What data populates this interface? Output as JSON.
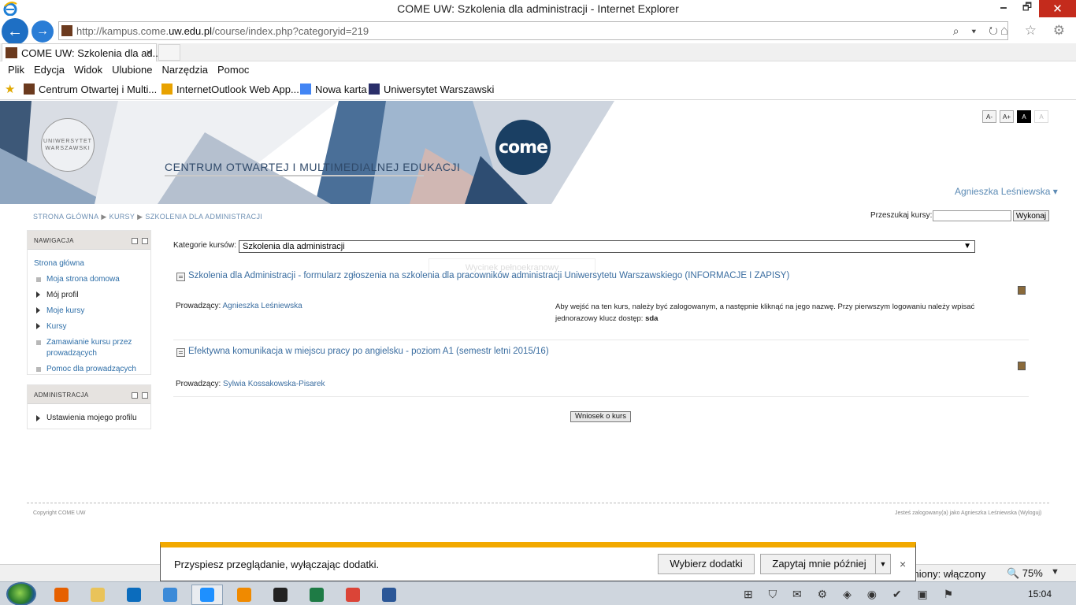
{
  "window": {
    "title": "COME UW: Szkolenia dla administracji - Internet Explorer",
    "minimize": "🗕",
    "maximize": "🗗",
    "close": "✕"
  },
  "address_bar": {
    "url_prefix": "http://kampus.come.",
    "url_domain": "uw.edu.pl",
    "url_suffix": "/course/index.php?categoryid=219",
    "tools": "⌕ ▾ ↻",
    "right_icons": "⌂ ☆ ⚙"
  },
  "tab": {
    "label": "COME UW: Szkolenia dla ad...",
    "close": "×"
  },
  "menu": [
    "Plik",
    "Edycja",
    "Widok",
    "Ulubione",
    "Narzędzia",
    "Pomoc"
  ],
  "favorites": [
    {
      "label": "Centrum Otwartej i Multi...",
      "color": "#6b3a1e"
    },
    {
      "label": "InternetOutlook Web App...",
      "color": "#e8a200"
    },
    {
      "label": "Nowa karta",
      "color": "#4285f4"
    },
    {
      "label": "Uniwersytet Warszawski",
      "color": "#2a2f6a"
    }
  ],
  "banner": {
    "seal_text": "UNIWERSYTET WARSZAWSKI",
    "title": "CENTRUM OTWARTEJ I MULTIMEDIALNEJ EDUKACJI",
    "logo": "come"
  },
  "accessibility": [
    "A-",
    "A+",
    "A",
    "A"
  ],
  "user": {
    "name": "Agnieszka Leśniewska ▾"
  },
  "breadcrumb": [
    "STRONA GŁÓWNA",
    "KURSY",
    "SZKOLENIA DLA ADMINISTRACJI"
  ],
  "search": {
    "label": "Przeszukaj kursy:",
    "button": "Wykonaj",
    "value": ""
  },
  "navigation": {
    "title": "NAWIGACJA",
    "root": "Strona główna",
    "items": [
      {
        "label": "Moja strona domowa"
      },
      {
        "label": "Mój profil"
      },
      {
        "label": "Moje kursy"
      },
      {
        "label": "Kursy"
      },
      {
        "label": "Zamawianie kursu przez prowadzących"
      },
      {
        "label": "Pomoc dla prowadzących"
      }
    ]
  },
  "administration": {
    "title": "ADMINISTRACJA",
    "item": "Ustawienia mojego profilu"
  },
  "categories": {
    "label": "Kategorie kursów:",
    "selected": "Szkolenia dla administracji",
    "ghost": "Wycinek pełnoekranowy"
  },
  "courses": [
    {
      "name": "Szkolenia dla Administracji - formularz zgłoszenia na szkolenia dla pracowników administracji Uniwersytetu Warszawskiego (INFORMACJE I ZAPISY)",
      "teacher_label": "Prowadzący:",
      "teacher": "Agnieszka Leśniewska",
      "summary": "Aby wejść na ten kurs, należy być zalogowanym, a następnie kliknąć na jego nazwę. Przy pierwszym logowaniu należy wpisać jednorazowy klucz dostęp:",
      "key": "sda"
    },
    {
      "name": "Efektywna komunikacja w miejscu pracy po angielsku - poziom A1 (semestr letni 2015/16)",
      "teacher_label": "Prowadzący:",
      "teacher": "Sylwia Kossakowska-Pisarek"
    }
  ],
  "request_button": "Wniosek o kurs",
  "footer": {
    "left": "Copyright COME UW",
    "right": "Jesteś zalogowany(a) jako Agnieszka Leśniewska (Wyloguj)"
  },
  "notification": {
    "message": "Przyspiesz przeglądanie, wyłączając dodatki.",
    "choose": "Wybierz dodatki",
    "later": "Zapytaj mnie później",
    "arrow": "▼",
    "close": "×"
  },
  "statusbar": {
    "protected": "roniony: włączony",
    "zoom": "🔍 75%",
    "zoom_arrow": "▼"
  },
  "taskbar": {
    "apps": [
      {
        "name": "firefox",
        "color": "#e66000"
      },
      {
        "name": "explorer",
        "color": "#e9c35a"
      },
      {
        "name": "outlook",
        "color": "#0b6cbd"
      },
      {
        "name": "remote",
        "color": "#3b8ad8"
      },
      {
        "name": "ie",
        "color": "#1e90ff"
      },
      {
        "name": "media",
        "color": "#f08a00"
      },
      {
        "name": "cmd",
        "color": "#222222"
      },
      {
        "name": "excel",
        "color": "#1e7b45"
      },
      {
        "name": "chrome",
        "color": "#db4437"
      },
      {
        "name": "word",
        "color": "#2b5797"
      }
    ],
    "tray": "⊞ ⛉ ✉ ⚙ ◈ ◉ ✔ ▣ ⚑",
    "time": "15:04"
  }
}
